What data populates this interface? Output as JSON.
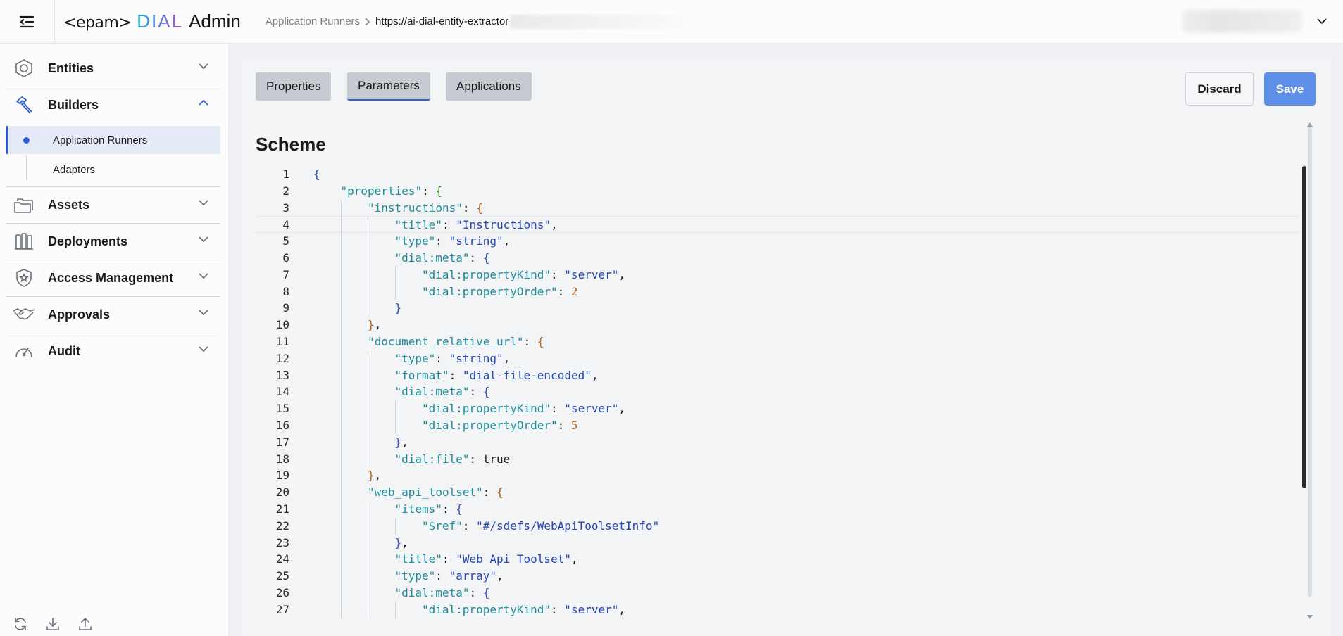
{
  "header": {
    "logo": {
      "brand": "<epam>",
      "product": "DIAL",
      "suffix": "Admin"
    },
    "breadcrumb": {
      "parent": "Application Runners",
      "current": "https://ai-dial-entity-extractor"
    }
  },
  "sidebar": {
    "sections": [
      {
        "id": "entities",
        "label": "Entities",
        "expanded": false,
        "icon": "hexagon-icon"
      },
      {
        "id": "builders",
        "label": "Builders",
        "expanded": true,
        "icon": "hammer-icon"
      },
      {
        "id": "assets",
        "label": "Assets",
        "expanded": false,
        "icon": "folders-icon"
      },
      {
        "id": "deployments",
        "label": "Deployments",
        "expanded": false,
        "icon": "deployments-icon"
      },
      {
        "id": "access",
        "label": "Access Management",
        "expanded": false,
        "icon": "shield-star-icon"
      },
      {
        "id": "approvals",
        "label": "Approvals",
        "expanded": false,
        "icon": "handshake-icon"
      },
      {
        "id": "audit",
        "label": "Audit",
        "expanded": false,
        "icon": "gauge-icon"
      }
    ],
    "builders_items": [
      {
        "label": "Application Runners",
        "active": true
      },
      {
        "label": "Adapters",
        "active": false
      }
    ],
    "footer_icons": [
      "refresh-icon",
      "download-icon",
      "upload-icon"
    ]
  },
  "tabs": [
    {
      "label": "Properties",
      "active": false
    },
    {
      "label": "Parameters",
      "active": true
    },
    {
      "label": "Applications",
      "active": false
    }
  ],
  "actions": {
    "discard": "Discard",
    "save": "Save"
  },
  "section_title": "Scheme",
  "editor": {
    "current_line": 4,
    "lines": [
      {
        "n": 1,
        "indent": 0,
        "parts": [
          [
            "br1",
            "{"
          ]
        ]
      },
      {
        "n": 2,
        "indent": 1,
        "parts": [
          [
            "k",
            "\"properties\""
          ],
          [
            "b",
            ": "
          ],
          [
            "br2",
            "{"
          ]
        ]
      },
      {
        "n": 3,
        "indent": 2,
        "parts": [
          [
            "k",
            "\"instructions\""
          ],
          [
            "b",
            ": "
          ],
          [
            "br3",
            "{"
          ]
        ]
      },
      {
        "n": 4,
        "indent": 3,
        "parts": [
          [
            "k",
            "\"title\""
          ],
          [
            "b",
            ": "
          ],
          [
            "s",
            "\"Instructions\""
          ],
          [
            "b",
            ","
          ]
        ]
      },
      {
        "n": 5,
        "indent": 3,
        "parts": [
          [
            "k",
            "\"type\""
          ],
          [
            "b",
            ": "
          ],
          [
            "s",
            "\"string\""
          ],
          [
            "b",
            ","
          ]
        ]
      },
      {
        "n": 6,
        "indent": 3,
        "parts": [
          [
            "k",
            "\"dial:meta\""
          ],
          [
            "b",
            ": "
          ],
          [
            "br1",
            "{"
          ]
        ]
      },
      {
        "n": 7,
        "indent": 4,
        "parts": [
          [
            "k",
            "\"dial:propertyKind\""
          ],
          [
            "b",
            ": "
          ],
          [
            "s",
            "\"server\""
          ],
          [
            "b",
            ","
          ]
        ]
      },
      {
        "n": 8,
        "indent": 4,
        "parts": [
          [
            "k",
            "\"dial:propertyOrder\""
          ],
          [
            "b",
            ": "
          ],
          [
            "n",
            "2"
          ]
        ]
      },
      {
        "n": 9,
        "indent": 3,
        "parts": [
          [
            "br1",
            "}"
          ]
        ]
      },
      {
        "n": 10,
        "indent": 2,
        "parts": [
          [
            "br3",
            "}"
          ],
          [
            "b",
            ","
          ]
        ]
      },
      {
        "n": 11,
        "indent": 2,
        "parts": [
          [
            "k",
            "\"document_relative_url\""
          ],
          [
            "b",
            ": "
          ],
          [
            "br3",
            "{"
          ]
        ]
      },
      {
        "n": 12,
        "indent": 3,
        "parts": [
          [
            "k",
            "\"type\""
          ],
          [
            "b",
            ": "
          ],
          [
            "s",
            "\"string\""
          ],
          [
            "b",
            ","
          ]
        ]
      },
      {
        "n": 13,
        "indent": 3,
        "parts": [
          [
            "k",
            "\"format\""
          ],
          [
            "b",
            ": "
          ],
          [
            "s",
            "\"dial-file-encoded\""
          ],
          [
            "b",
            ","
          ]
        ]
      },
      {
        "n": 14,
        "indent": 3,
        "parts": [
          [
            "k",
            "\"dial:meta\""
          ],
          [
            "b",
            ": "
          ],
          [
            "br1",
            "{"
          ]
        ]
      },
      {
        "n": 15,
        "indent": 4,
        "parts": [
          [
            "k",
            "\"dial:propertyKind\""
          ],
          [
            "b",
            ": "
          ],
          [
            "s",
            "\"server\""
          ],
          [
            "b",
            ","
          ]
        ]
      },
      {
        "n": 16,
        "indent": 4,
        "parts": [
          [
            "k",
            "\"dial:propertyOrder\""
          ],
          [
            "b",
            ": "
          ],
          [
            "n",
            "5"
          ]
        ]
      },
      {
        "n": 17,
        "indent": 3,
        "parts": [
          [
            "br1",
            "}"
          ],
          [
            "b",
            ","
          ]
        ]
      },
      {
        "n": 18,
        "indent": 3,
        "parts": [
          [
            "k",
            "\"dial:file\""
          ],
          [
            "b",
            ": "
          ],
          [
            "b",
            "true"
          ]
        ]
      },
      {
        "n": 19,
        "indent": 2,
        "parts": [
          [
            "br3",
            "}"
          ],
          [
            "b",
            ","
          ]
        ]
      },
      {
        "n": 20,
        "indent": 2,
        "parts": [
          [
            "k",
            "\"web_api_toolset\""
          ],
          [
            "b",
            ": "
          ],
          [
            "br3",
            "{"
          ]
        ]
      },
      {
        "n": 21,
        "indent": 3,
        "parts": [
          [
            "k",
            "\"items\""
          ],
          [
            "b",
            ": "
          ],
          [
            "br1",
            "{"
          ]
        ]
      },
      {
        "n": 22,
        "indent": 4,
        "parts": [
          [
            "k",
            "\"$ref\""
          ],
          [
            "b",
            ": "
          ],
          [
            "s",
            "\"#/sdefs/WebApiToolsetInfo\""
          ]
        ]
      },
      {
        "n": 23,
        "indent": 3,
        "parts": [
          [
            "br1",
            "}"
          ],
          [
            "b",
            ","
          ]
        ]
      },
      {
        "n": 24,
        "indent": 3,
        "parts": [
          [
            "k",
            "\"title\""
          ],
          [
            "b",
            ": "
          ],
          [
            "s",
            "\"Web Api Toolset\""
          ],
          [
            "b",
            ","
          ]
        ]
      },
      {
        "n": 25,
        "indent": 3,
        "parts": [
          [
            "k",
            "\"type\""
          ],
          [
            "b",
            ": "
          ],
          [
            "s",
            "\"array\""
          ],
          [
            "b",
            ","
          ]
        ]
      },
      {
        "n": 26,
        "indent": 3,
        "parts": [
          [
            "k",
            "\"dial:meta\""
          ],
          [
            "b",
            ": "
          ],
          [
            "br1",
            "{"
          ]
        ]
      },
      {
        "n": 27,
        "indent": 4,
        "parts": [
          [
            "k",
            "\"dial:propertyKind\""
          ],
          [
            "b",
            ": "
          ],
          [
            "s",
            "\"server\""
          ],
          [
            "b",
            ","
          ]
        ]
      }
    ]
  },
  "colors": {
    "accent": "#2d5fd7",
    "save_button": "#5d8ee8",
    "json_key": "#1e8d9d",
    "json_string": "#2346b8",
    "json_number": "#b8641e"
  }
}
